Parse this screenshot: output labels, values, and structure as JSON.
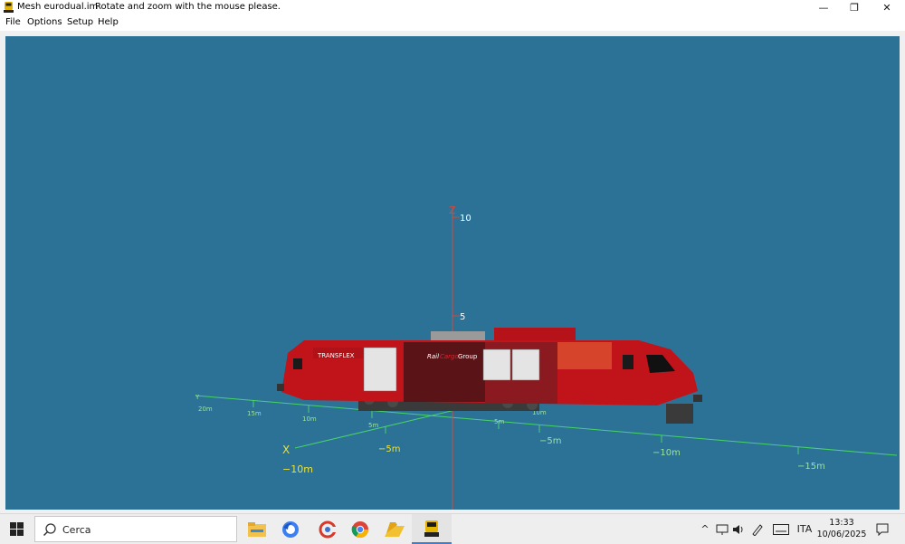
{
  "window": {
    "title": "Mesh eurodual.im",
    "hint": "Rotate and zoom with the mouse please.",
    "minimize_glyph": "—",
    "restore_glyph": "❐",
    "close_glyph": "✕"
  },
  "menu": {
    "items": [
      "File",
      "Options",
      "Setup",
      "Help"
    ]
  },
  "scene": {
    "background": "#2b7296",
    "axis_color": "#49d36a",
    "z_axis_color": "#d24b3f",
    "z_label": "Z",
    "x_label": "X",
    "y_label": "Y",
    "z_ticks": [
      "10",
      "5"
    ],
    "x_ticks": [
      "−5m",
      "−10m"
    ],
    "y_far_ticks": [
      "20m",
      "15m",
      "10m",
      "5m"
    ],
    "y_near_ticks": [
      "5m",
      "10m"
    ],
    "right_ticks": [
      "−5m",
      "−10m",
      "−15m"
    ],
    "loco": {
      "brand": "TRANSFLEX",
      "livery_1": "Rail",
      "livery_2": "Cargo",
      "livery_3": "Group",
      "body_color": "#c0141a"
    }
  },
  "taskbar": {
    "search_placeholder": "Cerca",
    "lang": "ITA",
    "time": "13:33",
    "date": "10/06/2025",
    "apps": [
      "file-explorer",
      "firefox",
      "ccleaner",
      "chrome",
      "folder",
      "train-sim"
    ]
  }
}
